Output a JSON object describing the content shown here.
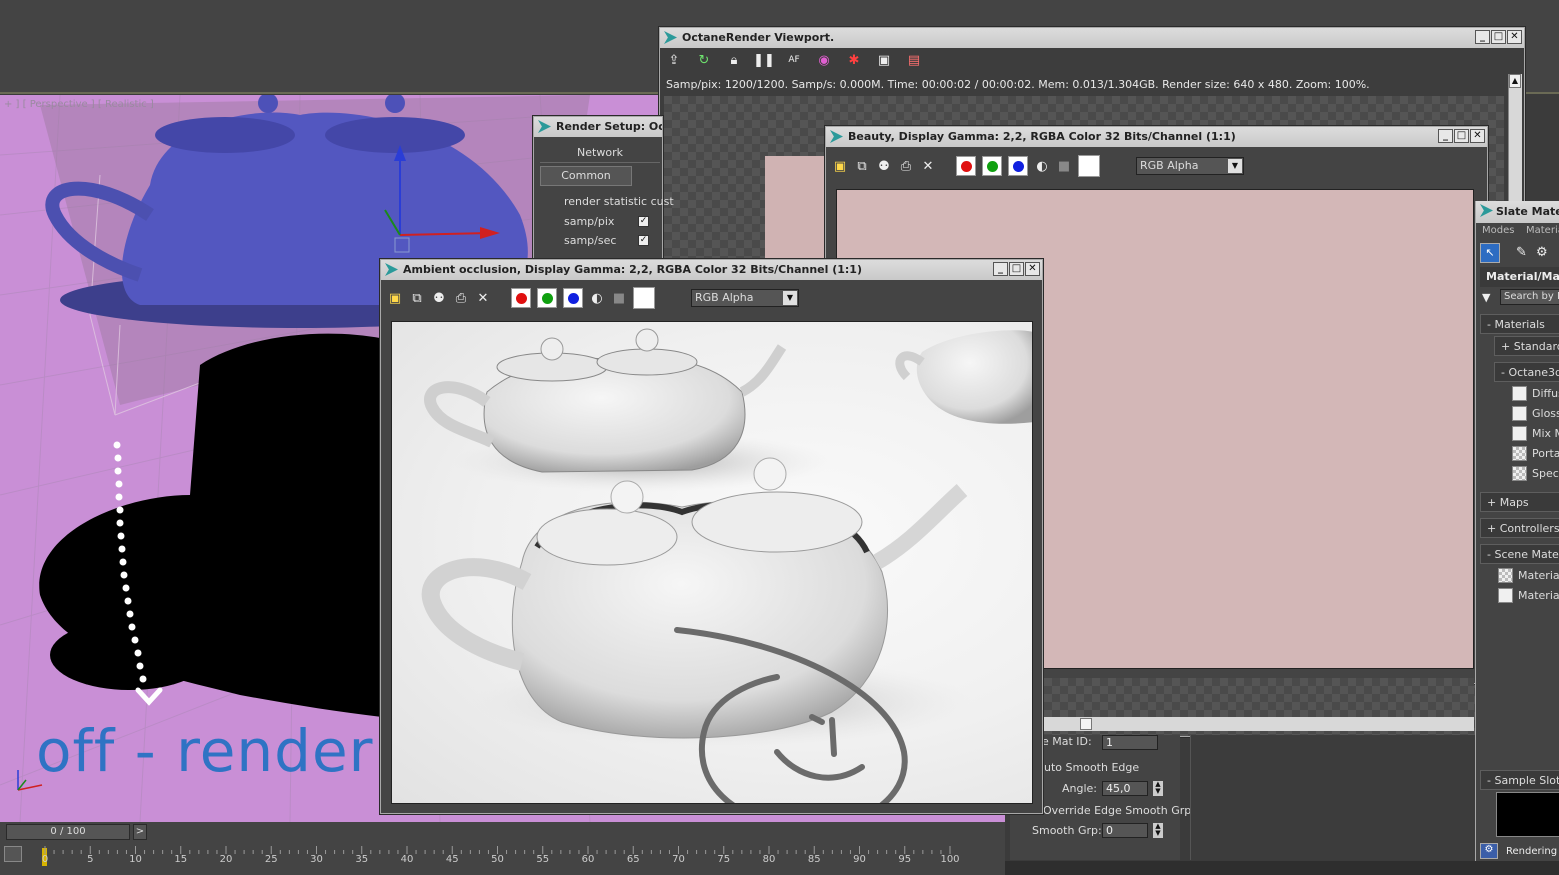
{
  "viewport": {
    "label": "+ ] [ Perspective ] [ Realistic ]",
    "overlay_text": "off - render"
  },
  "timeline": {
    "frame": "0 / 100",
    "next": ">",
    "ticks": [
      "0",
      "5",
      "10",
      "15",
      "20",
      "25",
      "30",
      "35",
      "40",
      "45",
      "50",
      "55",
      "60",
      "65",
      "70",
      "75",
      "80",
      "85",
      "90",
      "95",
      "100"
    ]
  },
  "octane": {
    "title": "OctaneRender Viewport.",
    "stats": "Samp/pix: 1200/1200.   Samp/s: 0.000M.   Time: 00:00:02 / 00:00:02.   Mem: 0.013/1.304GB.   Render size: 640 x 480.   Zoom: 100%.",
    "toolbar_icons": [
      "export-icon",
      "refresh-icon",
      "lock-icon",
      "pause-icon",
      "af-icon",
      "color-wheel-icon",
      "stop-icon",
      "monitor-icon",
      "film-icon"
    ],
    "af_label": "AF"
  },
  "render_setup": {
    "title": "Render Setup: Oct",
    "tab_network": "Network",
    "tab_common": "Common",
    "rows": [
      "render statistic cust",
      "samp/pix",
      "samp/sec"
    ]
  },
  "beauty": {
    "title": "Beauty, Display Gamma: 2,2, RGBA Color 32 Bits/Channel (1:1)",
    "channel": "RGB Alpha"
  },
  "ao": {
    "title": "Ambient occlusion, Display Gamma: 2,2, RGBA Color 32 Bits/Channel (1:1)",
    "channel": "RGB Alpha"
  },
  "slate": {
    "title": "Slate Mate",
    "menu_modes": "Modes",
    "menu_material": "Materia",
    "browser_label": "Material/Map",
    "search_placeholder": "Search by N",
    "group_materials": "- Materials",
    "group_standard": "+ Standard",
    "group_octane": "- Octane3d",
    "items": [
      "Diffus",
      "Gloss",
      "Mix M",
      "Porta",
      "Specu"
    ],
    "group_maps": "+ Maps",
    "group_controllers": "+ Controllers",
    "group_scene": "- Scene Mater",
    "scene_items": [
      "Material",
      "Material"
    ],
    "group_sample": "- Sample Slot",
    "status": "Rendering"
  },
  "modify": {
    "mat_id_label": "e Mat ID:",
    "mat_id_value": "1",
    "auto_smooth": "uto Smooth Edge",
    "angle_label": "Angle:",
    "angle_value": "45,0",
    "override": "Override Edge Smooth Grp",
    "smooth_grp_label": "Smooth Grp:",
    "smooth_grp_value": "0"
  },
  "colors": {
    "viewport_bg": "#c98fd6",
    "teapot": "#5357c0",
    "overlay_text": "#2f73c4",
    "beauty_bg": "#d3b7b7"
  }
}
